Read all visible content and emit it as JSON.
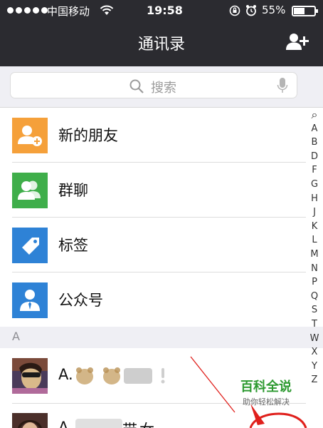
{
  "status_bar": {
    "carrier": "中国移动",
    "time": "19:58",
    "battery_percent": "55%",
    "battery_level": 0.55
  },
  "nav": {
    "title": "通讯录",
    "add_icon": "add-contact-icon"
  },
  "search": {
    "placeholder": "搜索",
    "icon": "search-icon",
    "mic_icon": "microphone-icon"
  },
  "menu_items": [
    {
      "label": "新的朋友",
      "icon": "new-friend-icon",
      "color": "#f5a03a"
    },
    {
      "label": "群聊",
      "icon": "group-chat-icon",
      "color": "#3fae4a"
    },
    {
      "label": "标签",
      "icon": "tag-icon",
      "color": "#2e82d6"
    },
    {
      "label": "公众号",
      "icon": "official-account-icon",
      "color": "#2e82d6"
    }
  ],
  "section_header": "A",
  "contacts": [
    {
      "name": "A."
    },
    {
      "name": "A",
      "name_suffix": "带",
      "name_suffix2": "女"
    }
  ],
  "index": [
    "Q",
    "A",
    "B",
    "D",
    "F",
    "G",
    "H",
    "J",
    "K",
    "L",
    "M",
    "N",
    "P",
    "Q",
    "S",
    "T",
    "W",
    "X",
    "Y",
    "Z"
  ],
  "watermark": {
    "title": "百科全说",
    "subtitle": "助你轻松解决"
  },
  "colors": {
    "nav_bg": "#2b2b30",
    "page_bg": "#efeff4",
    "watermark_green": "#2e9a31",
    "annotation_red": "#e0201c"
  }
}
